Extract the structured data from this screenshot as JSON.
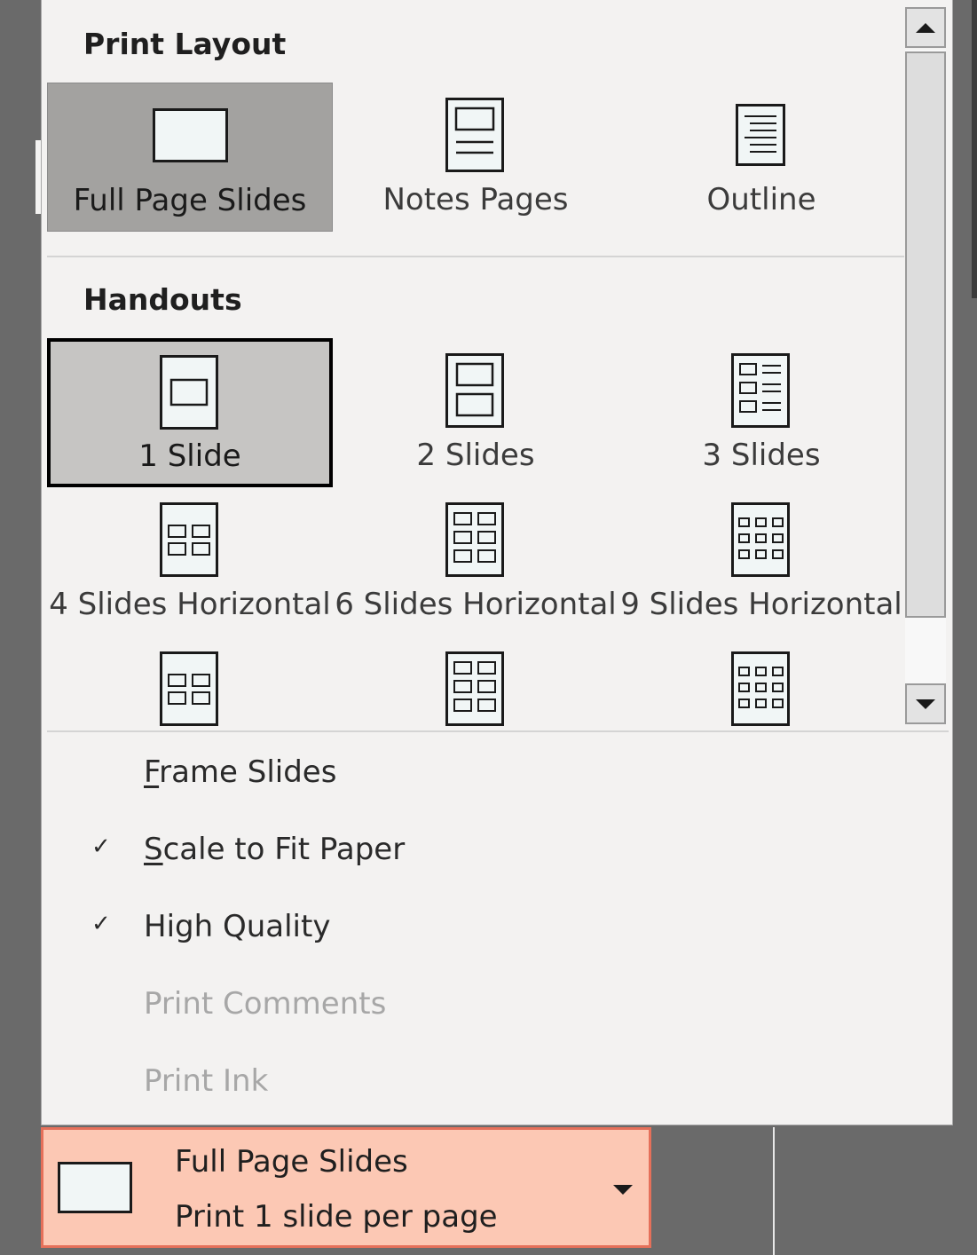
{
  "print_layout": {
    "heading": "Print Layout",
    "items": [
      {
        "label": "Full Page Slides",
        "icon": "full-page-slides-icon"
      },
      {
        "label": "Notes Pages",
        "icon": "notes-pages-icon"
      },
      {
        "label": "Outline",
        "icon": "outline-icon"
      }
    ]
  },
  "handouts": {
    "heading": "Handouts",
    "items": [
      {
        "label": "1 Slide",
        "icon": "handout-1-slide-icon"
      },
      {
        "label": "2 Slides",
        "icon": "handout-2-slides-icon"
      },
      {
        "label": "3 Slides",
        "icon": "handout-3-slides-icon"
      },
      {
        "label": "4 Slides Horizontal",
        "icon": "handout-4-slides-horizontal-icon"
      },
      {
        "label": "6 Slides Horizontal",
        "icon": "handout-6-slides-horizontal-icon"
      },
      {
        "label": "9 Slides Horizontal",
        "icon": "handout-9-slides-horizontal-icon"
      },
      {
        "label": "",
        "icon": "handout-4-slides-vertical-icon"
      },
      {
        "label": "",
        "icon": "handout-6-slides-vertical-icon"
      },
      {
        "label": "",
        "icon": "handout-9-slides-vertical-icon"
      }
    ]
  },
  "options": [
    {
      "label": "Frame Slides",
      "checked": false,
      "enabled": true,
      "access_key": "F"
    },
    {
      "label": "Scale to Fit Paper",
      "checked": true,
      "enabled": true,
      "access_key": "S"
    },
    {
      "label": "High Quality",
      "checked": true,
      "enabled": true
    },
    {
      "label": "Print Comments",
      "checked": false,
      "enabled": false
    },
    {
      "label": "Print Ink",
      "checked": false,
      "enabled": false
    }
  ],
  "check_mark": "✓",
  "current_selection": {
    "title": "Full Page Slides",
    "subtitle": "Print 1 slide per page"
  },
  "colors": {
    "selection_box_bg": "#fcc8b4",
    "selection_box_border": "#e5705a",
    "selected_item_bg": "#a3a2a0",
    "focused_item_border": "#000000"
  }
}
